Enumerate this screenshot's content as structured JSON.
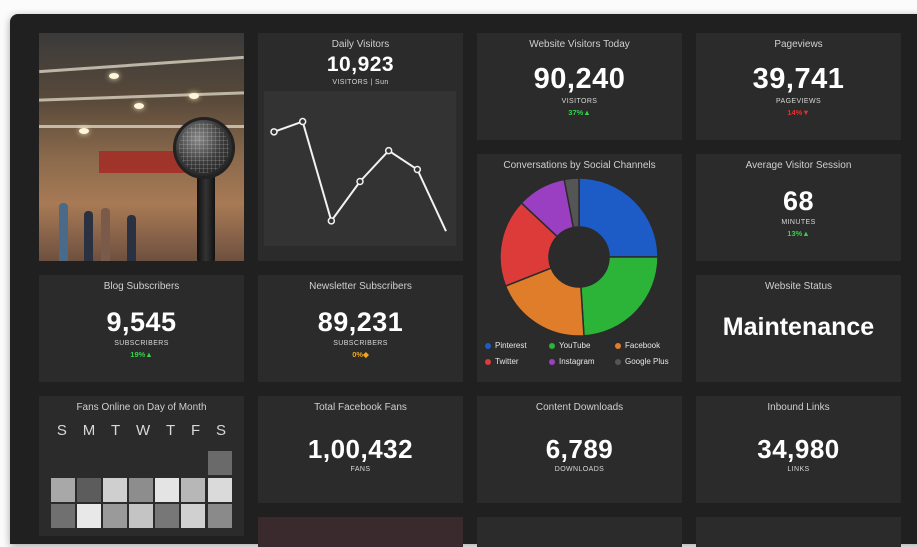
{
  "tiles": {
    "daily_visitors": {
      "title": "Daily Visitors",
      "value": "10,923",
      "unit": "VISITORS | Sun"
    },
    "website_today": {
      "title": "Website Visitors Today",
      "value": "90,240",
      "unit": "VISITORS",
      "delta": "37%▲"
    },
    "pageviews": {
      "title": "Pageviews",
      "value": "39,741",
      "unit": "PAGEVIEWS",
      "delta": "14%▼"
    },
    "avg_session": {
      "title": "Average Visitor Session",
      "value": "68",
      "unit": "MINUTES",
      "delta": "13%▲"
    },
    "blog_subscribers": {
      "title": "Blog Subscribers",
      "value": "9,545",
      "unit": "SUBSCRIBERS",
      "delta": "19%▲"
    },
    "newsletter": {
      "title": "Newsletter Subscribers",
      "value": "89,231",
      "unit": "SUBSCRIBERS",
      "delta": "0%◆"
    },
    "website_status": {
      "title": "Website Status",
      "value": "Maintenance"
    },
    "fans_online": {
      "title": "Fans Online on Day of Month",
      "days": [
        "S",
        "M",
        "T",
        "W",
        "T",
        "F",
        "S"
      ]
    },
    "facebook_fans": {
      "title": "Total Facebook Fans",
      "value": "1,00,432",
      "unit": "FANS"
    },
    "downloads": {
      "title": "Content Downloads",
      "value": "6,789",
      "unit": "DOWNLOADS"
    },
    "inbound_links": {
      "title": "Inbound Links",
      "value": "34,980",
      "unit": "LINKS"
    }
  },
  "social": {
    "title": "Conversations by Social Channels",
    "legend": [
      "Pinterest",
      "YouTube",
      "Facebook",
      "Twitter",
      "Instagram",
      "Google Plus"
    ]
  },
  "colors": {
    "up": "#33d14a",
    "down": "#e03131",
    "flat": "#f2a51a"
  },
  "chart_data": [
    {
      "type": "line",
      "title": "Daily Visitors",
      "x": [
        1,
        2,
        3,
        4,
        5,
        6,
        7
      ],
      "values": [
        62,
        68,
        10,
        33,
        51,
        40,
        4
      ],
      "ylim": [
        0,
        80
      ]
    },
    {
      "type": "pie",
      "title": "Conversations by Social Channels",
      "categories": [
        "Pinterest",
        "YouTube",
        "Facebook",
        "Twitter",
        "Instagram",
        "Google Plus"
      ],
      "values": [
        25,
        24,
        20,
        18,
        10,
        3
      ],
      "colors": [
        "#1d5bc7",
        "#2bb437",
        "#e07d2b",
        "#dd3a3a",
        "#9b3fc2",
        "#555555"
      ]
    }
  ]
}
